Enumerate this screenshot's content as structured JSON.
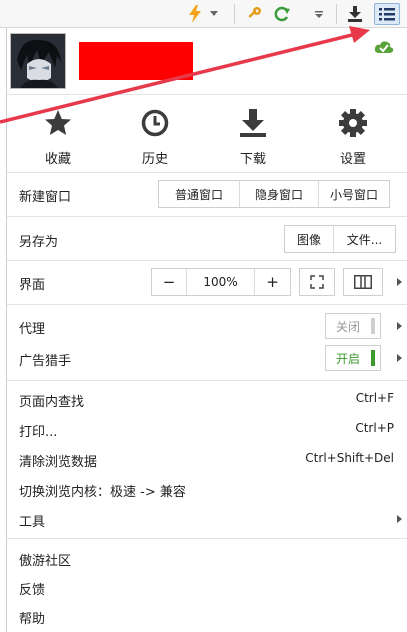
{
  "header": {
    "zoom_out": "−",
    "zoom_in": "+"
  },
  "icons": [
    {
      "id": "favorites",
      "label": "收藏"
    },
    {
      "id": "history",
      "label": "历史"
    },
    {
      "id": "download",
      "label": "下载"
    },
    {
      "id": "settings",
      "label": "设置"
    }
  ],
  "new_window": {
    "label": "新建窗口",
    "buttons": [
      "普通窗口",
      "隐身窗口",
      "小号窗口"
    ]
  },
  "save_as": {
    "label": "另存为",
    "buttons": [
      "图像",
      "文件..."
    ]
  },
  "interface": {
    "label": "界面",
    "zoom_out": "−",
    "zoom_value": "100%",
    "zoom_in": "+"
  },
  "proxy": {
    "label": "代理",
    "state": "关闭"
  },
  "adblock": {
    "label": "广告猎手",
    "state": "开启"
  },
  "find": {
    "label": "页面内查找",
    "shortcut": "Ctrl+F"
  },
  "print": {
    "label": "打印...",
    "shortcut": "Ctrl+P"
  },
  "clear": {
    "label": "清除浏览数据",
    "shortcut": "Ctrl+Shift+Del"
  },
  "kernel": {
    "label": "切换浏览内核：极速 -> 兼容"
  },
  "tools": {
    "label": "工具"
  },
  "community": {
    "label": "傲游社区"
  },
  "feedback": {
    "label": "反馈"
  },
  "help": {
    "label": "帮助"
  },
  "colors": {
    "accent_blue": "#3a7fd5",
    "toggle_on": "#3e9a2e",
    "redaction": "#ff0000",
    "annotation_arrow": "#e8394a"
  }
}
